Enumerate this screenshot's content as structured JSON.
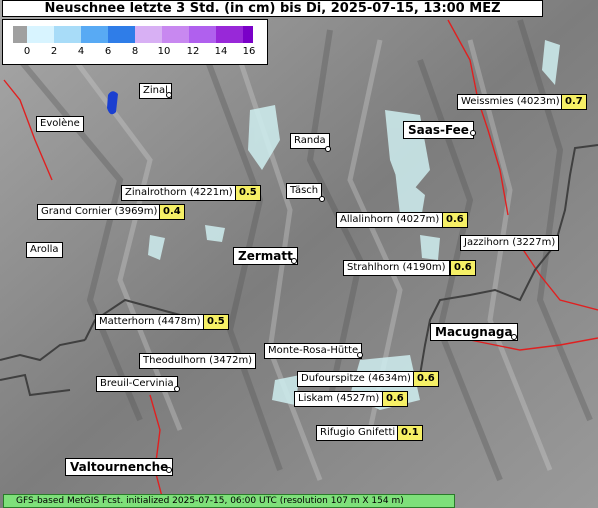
{
  "title": "Neuschnee letzte 3 Std. (in cm) bis Di, 2025-07-15, 13:00 MEZ",
  "legend": {
    "colors": [
      "#a0a0a0",
      "#d8f4ff",
      "#a8dcf8",
      "#80c4f8",
      "#58aaf4",
      "#2f7de8",
      "#d8b0f4",
      "#c888f0",
      "#b060ee",
      "#9828d8",
      "#7a00c8"
    ],
    "ticks": [
      "0",
      "2",
      "4",
      "6",
      "8",
      "10",
      "12",
      "14",
      "16"
    ]
  },
  "places": [
    {
      "name": "Zinal"
    },
    {
      "name": "Evolène"
    },
    {
      "name": "Randa"
    },
    {
      "name": "Täsch"
    },
    {
      "name": "Arolla"
    },
    {
      "name": "Saas-Fee"
    },
    {
      "name": "Zermatt"
    },
    {
      "name": "Macugnaga"
    },
    {
      "name": "Monte-Rosa-Hütte"
    },
    {
      "name": "Breuil-Cervinia"
    },
    {
      "name": "Valtournenche"
    },
    {
      "name": "Theodulhorn (3472m)"
    },
    {
      "name": "Jazzihorn (3227m)"
    }
  ],
  "peaks": [
    {
      "name": "Weissmies (4023m)",
      "value": "0.7"
    },
    {
      "name": "Zinalrothorn (4221m)",
      "value": "0.5"
    },
    {
      "name": "Grand Cornier (3969m)",
      "value": "0.4"
    },
    {
      "name": "Allalinhorn (4027m)",
      "value": "0.6"
    },
    {
      "name": "Strahlhorn (4190m)",
      "value": "0.6"
    },
    {
      "name": "Matterhorn (4478m)",
      "value": "0.5"
    },
    {
      "name": "Dufourspitze (4634m)",
      "value": "0.6"
    },
    {
      "name": "Liskam (4527m)",
      "value": "0.6"
    },
    {
      "name": "Rifugio Gnifetti",
      "value": "0.1"
    }
  ],
  "footer": "GFS-based MetGIS Fcst. initialized 2025-07-15, 06:00 UTC  (resolution 107 m X 154 m)"
}
